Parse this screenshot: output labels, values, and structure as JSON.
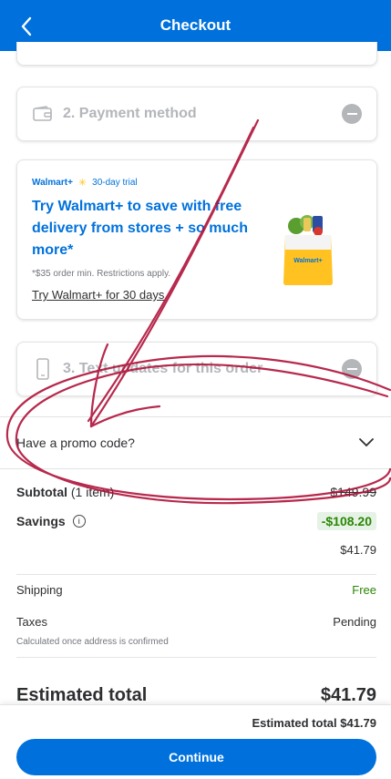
{
  "header": {
    "title": "Checkout"
  },
  "steps": {
    "payment": "2. Payment method",
    "text_updates": "3. Text updates for this order"
  },
  "walmart_plus": {
    "logo": "Walmart+",
    "trial": "30-day trial",
    "headline": "Try Walmart+ to save with free delivery from stores + so much more*",
    "fine_print": "*$35 order min. Restrictions apply.",
    "link": "Try Walmart+ for 30 days",
    "bag_label": "Walmart+"
  },
  "promo": {
    "label": "Have a promo code?"
  },
  "summary": {
    "subtotal_label": "Subtotal",
    "subtotal_count": "(1 item)",
    "subtotal_original": "$149.99",
    "savings_label": "Savings",
    "savings_value": "-$108.20",
    "subtotal_after": "$41.79",
    "shipping_label": "Shipping",
    "shipping_value": "Free",
    "taxes_label": "Taxes",
    "taxes_value": "Pending",
    "taxes_note": "Calculated once address is confirmed",
    "estimated_label": "Estimated total",
    "estimated_value": "$41.79"
  },
  "footer": {
    "total_text": "Estimated total $41.79",
    "continue_label": "Continue"
  },
  "colors": {
    "brand_blue": "#0071dc",
    "accent_yellow": "#ffc220",
    "savings_green": "#2a8703",
    "annotation_red": "#b0123a"
  }
}
